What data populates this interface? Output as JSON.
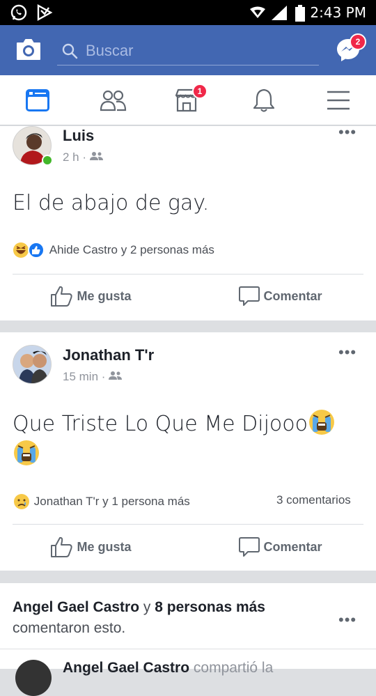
{
  "status_bar": {
    "time": "2:43 PM"
  },
  "header": {
    "search_placeholder": "Buscar",
    "messenger_badge": "2"
  },
  "nav": {
    "marketplace_badge": "1"
  },
  "posts": [
    {
      "author": "Luis",
      "time": "2 h",
      "text": "El de abajo de gay.",
      "reactions": "Ahide Castro y 2 personas más",
      "comments": "",
      "like_label": "Me gusta",
      "comment_label": "Comentar"
    },
    {
      "author": "Jonathan T'r",
      "time": "15 min",
      "text": "Que Triste Lo Que Me Dijooo",
      "reactions": "Jonathan T'r y 1 persona más",
      "comments": "3 comentarios",
      "like_label": "Me gusta",
      "comment_label": "Comentar"
    }
  ],
  "activity": {
    "name": "Angel Gael Castro",
    "conj": " y ",
    "others": "8 personas más",
    "rest": "comentaron esto.",
    "cutoff_name": "Angel Gael Castro",
    "cutoff_rest": " compartió la"
  },
  "colors": {
    "brand": "#4267b2",
    "badge": "#f02849",
    "online": "#42b72a"
  }
}
